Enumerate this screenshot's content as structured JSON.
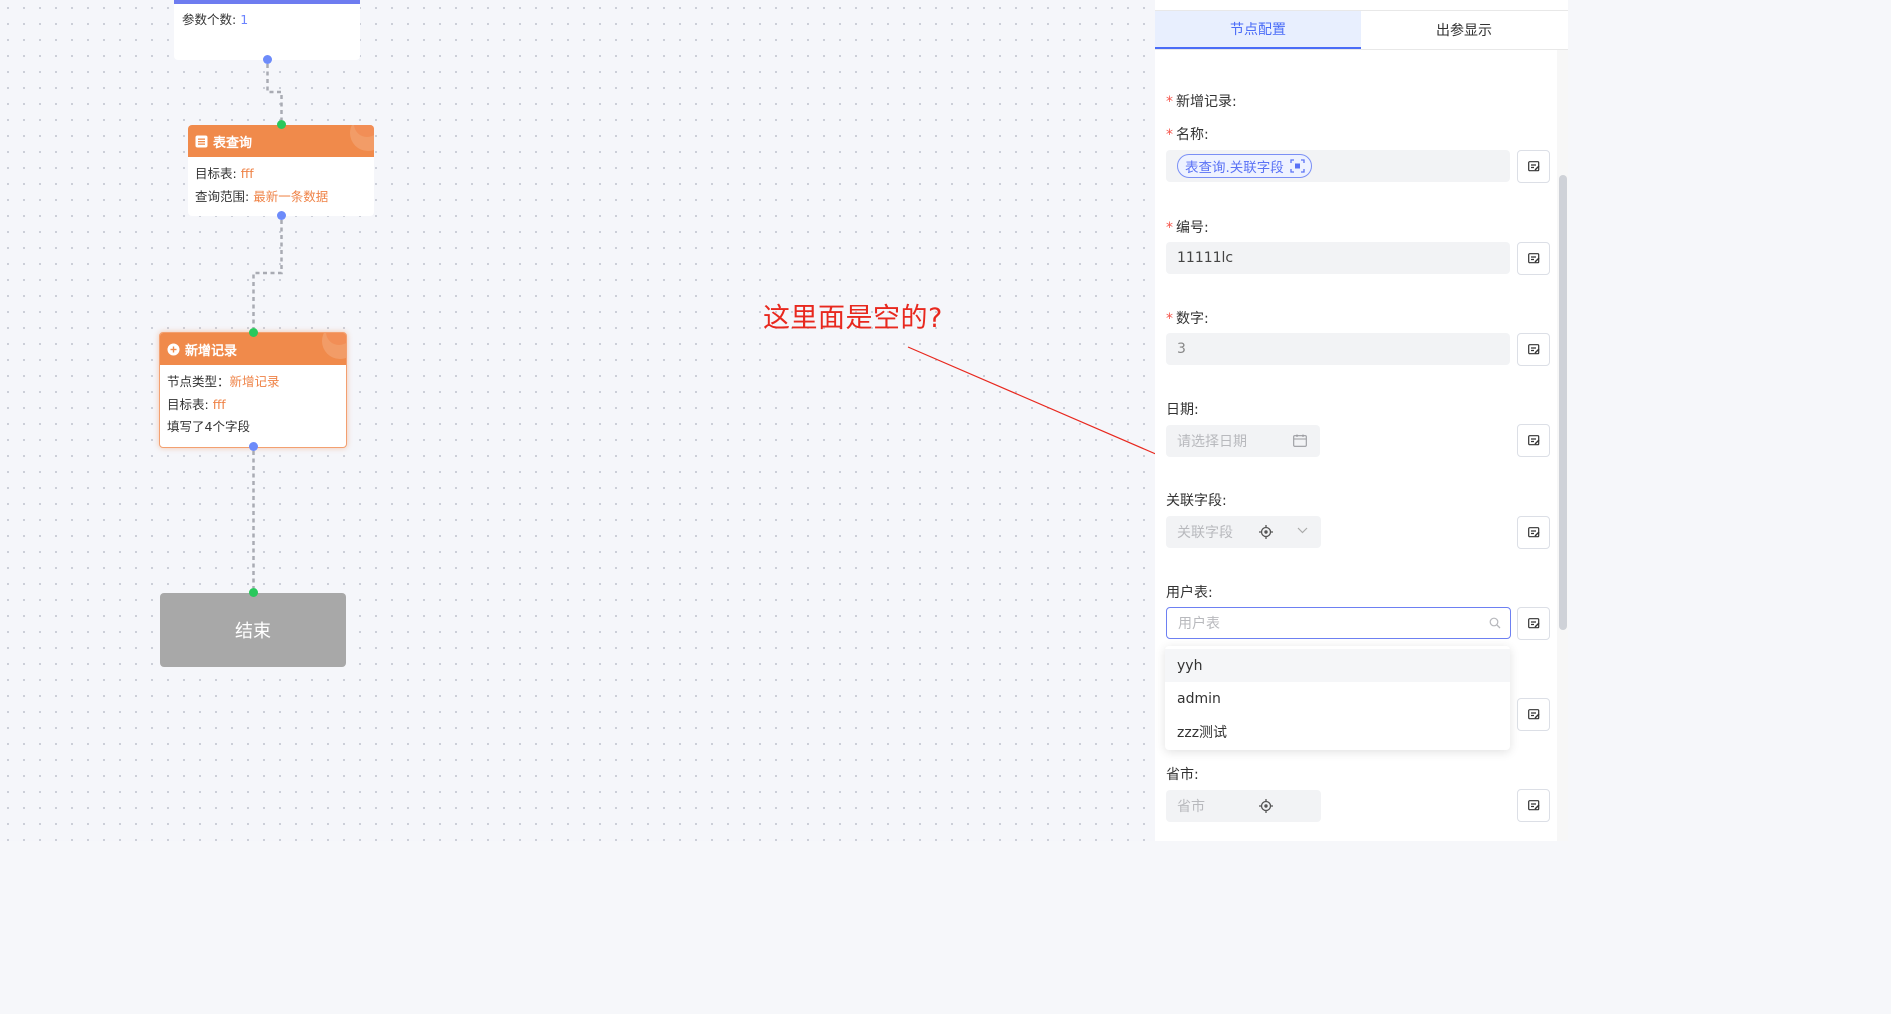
{
  "canvas": {
    "nodes": {
      "top": {
        "param_label": "参数个数: ",
        "param_value": "1"
      },
      "query": {
        "title": "表查询",
        "target_label": "目标表: ",
        "target_value": "fff",
        "range_label": "查询范围: ",
        "range_value": "最新一条数据"
      },
      "add": {
        "title": "新增记录",
        "type_label": "节点类型：",
        "type_value": "新增记录",
        "target_label": "目标表: ",
        "target_value": "fff",
        "filled": "填写了4个字段"
      },
      "end": {
        "label": "结束"
      }
    },
    "annotation": "这里面是空的?"
  },
  "panel": {
    "tabs": [
      {
        "label": "节点配置",
        "active": true
      },
      {
        "label": "出参显示",
        "active": false
      }
    ],
    "section_title": "新增记录:",
    "fields": {
      "name": {
        "label": "名称:",
        "required": true,
        "tag": "表查询.关联字段"
      },
      "code": {
        "label": "编号:",
        "required": true,
        "value": "11111lc"
      },
      "number": {
        "label": "数字:",
        "required": true,
        "value": "3"
      },
      "date": {
        "label": "日期:",
        "placeholder": "请选择日期"
      },
      "link_field": {
        "label": "关联字段:",
        "placeholder": "关联字段"
      },
      "user_table": {
        "label": "用户表:",
        "placeholder": "用户表"
      },
      "province": {
        "label": "省市:",
        "placeholder": "省市"
      }
    },
    "dropdown_options": [
      "yyh",
      "admin",
      "zzz测试"
    ],
    "required_mark": "*"
  },
  "colors": {
    "accent": "#4a6cf7",
    "node_header": "#f08a4b",
    "annotation": "#e8281e",
    "port_blue": "#6d8bfa",
    "port_green": "#29c85c"
  }
}
